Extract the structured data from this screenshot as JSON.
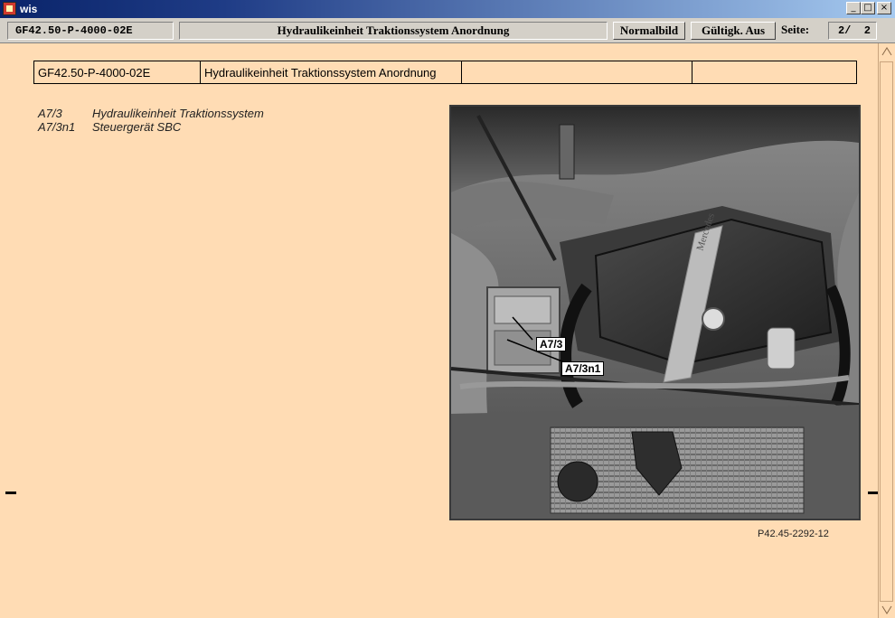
{
  "window": {
    "title": "wis",
    "controls": [
      "_",
      "□",
      "×"
    ]
  },
  "toolbar": {
    "doc_id": "GF42.50-P-4000-02E",
    "title": "Hydraulikeinheit Traktionssystem Anordnung",
    "normalbild_label": "Normalbild",
    "gueltigk_label": "Gültigk. Aus",
    "seite_label": "Seite:",
    "page_value": "2/  2"
  },
  "header_table": {
    "doc_id": "GF42.50-P-4000-02E",
    "title": "Hydraulikeinheit Traktionssystem Anordnung",
    "cell3": "",
    "cell4": ""
  },
  "legend": [
    {
      "code": "A7/3",
      "text": "Hydraulikeinheit Traktionssystem"
    },
    {
      "code": "A7/3n1",
      "text": "Steuergerät SBC"
    }
  ],
  "figure": {
    "callouts": [
      "A7/3",
      "A7/3n1"
    ],
    "engine_badge": "Mercedes",
    "reference": "P42.45-2292-12"
  },
  "colors": {
    "document_bg": "#ffdcb4",
    "chrome": "#d4d0c8",
    "titlebar": "#0a246a"
  }
}
